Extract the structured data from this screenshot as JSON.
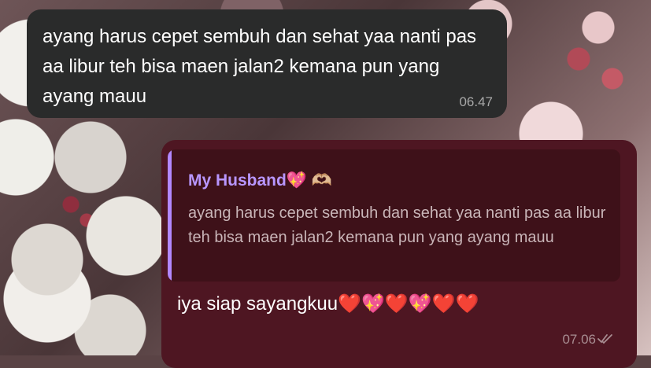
{
  "incoming_message": {
    "text": "ayang harus cepet sembuh dan sehat yaa nanti pas aa libur teh bisa maen jalan2 kemana pun yang ayang mauu",
    "time": "06.47"
  },
  "outgoing_message": {
    "quote": {
      "sender": "My Husband💖 🫶🏼",
      "text": "ayang harus cepet sembuh dan sehat yaa nanti pas aa libur teh bisa maen jalan2 kemana pun yang ayang mauu"
    },
    "text": "iya siap sayangkuu❤️💖❤️💖❤️❤️",
    "time": "07.06",
    "status_icon": "double-check-icon"
  },
  "colors": {
    "incoming_bubble": "#2a2b2b",
    "outgoing_bubble": "#4e1622",
    "quote_accent": "#b388ff"
  }
}
